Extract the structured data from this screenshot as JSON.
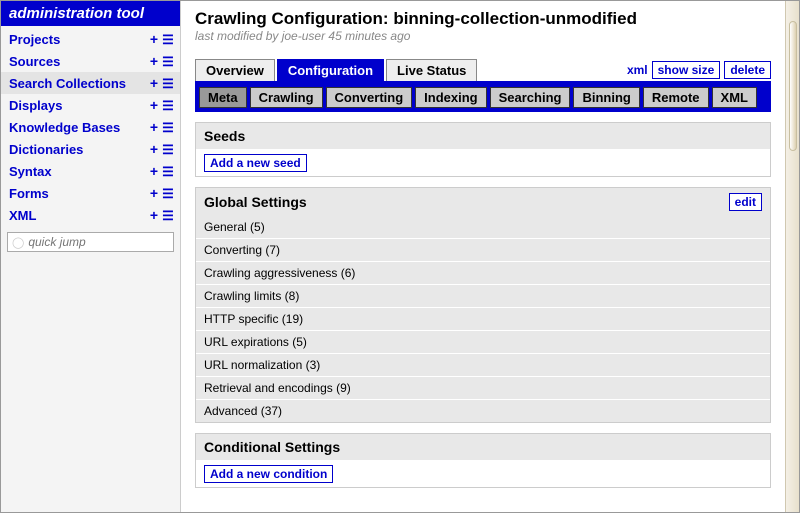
{
  "app_title": "administration tool",
  "sidebar": {
    "items": [
      {
        "label": "Projects",
        "active": false
      },
      {
        "label": "Sources",
        "active": false
      },
      {
        "label": "Search Collections",
        "active": true
      },
      {
        "label": "Displays",
        "active": false
      },
      {
        "label": "Knowledge Bases",
        "active": false
      },
      {
        "label": "Dictionaries",
        "active": false
      },
      {
        "label": "Syntax",
        "active": false
      },
      {
        "label": "Forms",
        "active": false
      },
      {
        "label": "XML",
        "active": false
      }
    ],
    "quick_jump_placeholder": "quick jump"
  },
  "page": {
    "title": "Crawling Configuration: binning-collection-unmodified",
    "last_modified": "last modified by joe-user 45 minutes ago"
  },
  "tabs": {
    "items": [
      {
        "label": "Overview",
        "active": false
      },
      {
        "label": "Configuration",
        "active": true
      },
      {
        "label": "Live Status",
        "active": false
      }
    ],
    "actions": {
      "xml": "xml",
      "show_size": "show size",
      "delete": "delete"
    }
  },
  "subtabs": [
    {
      "label": "Meta",
      "active": true
    },
    {
      "label": "Crawling",
      "active": false
    },
    {
      "label": "Converting",
      "active": false
    },
    {
      "label": "Indexing",
      "active": false
    },
    {
      "label": "Searching",
      "active": false
    },
    {
      "label": "Binning",
      "active": false
    },
    {
      "label": "Remote",
      "active": false
    },
    {
      "label": "XML",
      "active": false
    }
  ],
  "sections": {
    "seeds": {
      "title": "Seeds",
      "add_label": "Add a new seed"
    },
    "global": {
      "title": "Global Settings",
      "edit_label": "edit",
      "rows": [
        "General (5)",
        "Converting (7)",
        "Crawling aggressiveness (6)",
        "Crawling limits (8)",
        "HTTP specific (19)",
        "URL expirations (5)",
        "URL normalization (3)",
        "Retrieval and encodings (9)",
        "Advanced (37)"
      ]
    },
    "conditional": {
      "title": "Conditional Settings",
      "add_label": "Add a new condition"
    }
  }
}
